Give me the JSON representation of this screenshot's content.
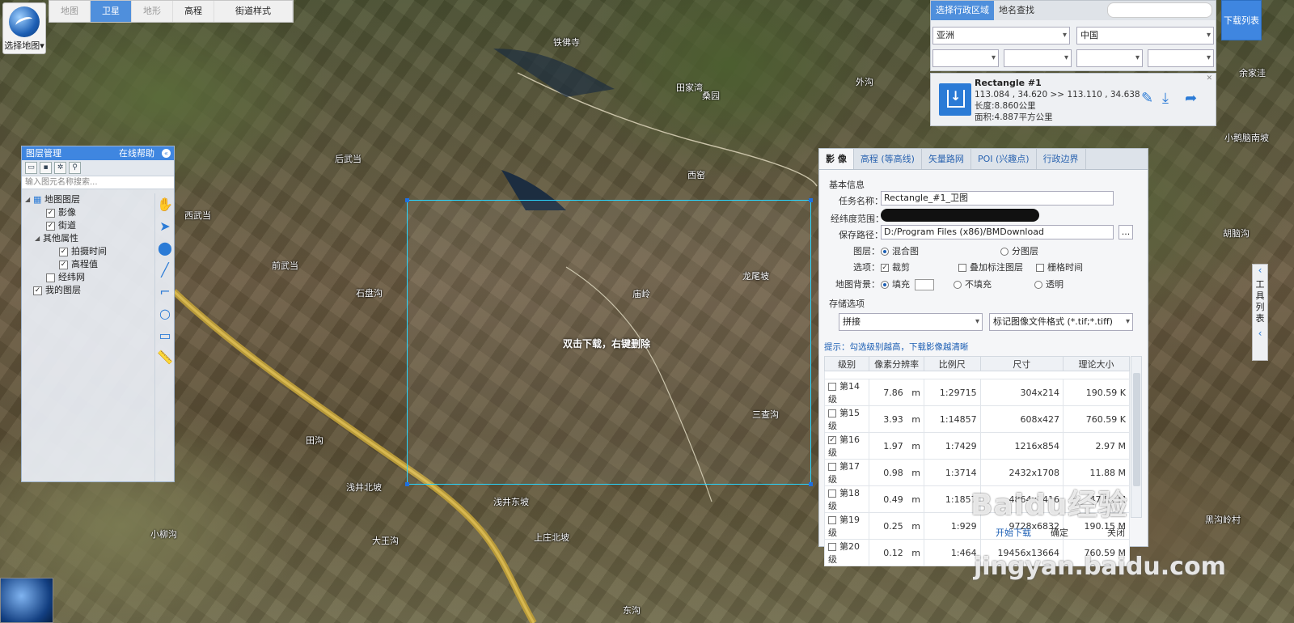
{
  "map_switch": {
    "label": "选择地图",
    "arrow": "▾"
  },
  "map_tabs": [
    "地图",
    "卫星",
    "地形",
    "高程",
    "街道样式"
  ],
  "region_panel": {
    "tabs": [
      "选择行政区域",
      "地名查找"
    ],
    "continent": "亚洲",
    "country": "中国"
  },
  "download_list_label": "下载列表",
  "rect_card": {
    "title": "Rectangle #1",
    "coords": "113.084 , 34.620 >> 113.110 , 34.638",
    "length": "长度:8.860公里",
    "area": "面积:4.887平方公里"
  },
  "layer_panel": {
    "title": "图层管理",
    "help": "在线帮助",
    "search_placeholder": "输入图元名称搜索...",
    "tree": {
      "map_layers": "地图图层",
      "imagery": "影像",
      "streets": "街道",
      "other_attr": "其他属性",
      "shot_time": "拍摄时间",
      "elevation": "高程值",
      "graticule": "经纬网",
      "my_layers": "我的图层"
    }
  },
  "selection_hint": "双击下载，右键删除",
  "places": {
    "p1": "铁佛寺",
    "p2": "田家湾",
    "p3": "外沟",
    "p4": "桑园",
    "p5": "后武当",
    "p6": "西武当",
    "p7": "前武当",
    "p8": "石盘沟",
    "p9": "西窑",
    "p10": "龙尾坡",
    "p11": "庙岭",
    "p12": "三查沟",
    "p13": "田沟",
    "p14": "浅井北坡",
    "p15": "浅井东坡",
    "p16": "上庄北坡",
    "p17": "大王沟",
    "p18": "小柳沟",
    "p19": "余家洼",
    "p20": "小鹅脑南坡",
    "p21": "胡脑沟",
    "p22": "黑沟岭村",
    "p23": "东沟"
  },
  "download_panel": {
    "tabs": [
      "影 像",
      "高程 (等高线)",
      "矢量路网",
      "POI (兴趣点)",
      "行政边界"
    ],
    "basic_info": "基本信息",
    "task_label": "任务名称：",
    "task_value": "Rectangle_#1_卫图",
    "range_label": "经纬度范围：",
    "save_label": "保存路径：",
    "save_value": "D:/Program Files (x86)/BMDownload",
    "browse": "...",
    "layer_label": "图层：",
    "layer_opt1": "混合图",
    "layer_opt2": "分图层",
    "options_label": "选项：",
    "opt_crop": "裁剪",
    "opt_overlay": "叠加标注图层",
    "opt_grid_time": "栅格时间",
    "bg_label": "地图背景：",
    "bg_fill": "填充",
    "bg_nofill": "不填充",
    "bg_transparent": "透明",
    "storage": "存储选项",
    "store_mode": "拼接",
    "store_format": "标记图像文件格式 (*.tif;*.tiff)",
    "tip": "提示：勾选级别越高，下载影像越清晰",
    "headers": [
      "级别",
      "像素分辨率",
      "比例尺",
      "尺寸",
      "理论大小"
    ],
    "rows": [
      {
        "level": "第14级",
        "res": "7.86",
        "unit": "m",
        "scale": "1:29715",
        "size": "304x214",
        "est": "190.59 K",
        "checked": false
      },
      {
        "level": "第15级",
        "res": "3.93",
        "unit": "m",
        "scale": "1:14857",
        "size": "608x427",
        "est": "760.59 K",
        "checked": false
      },
      {
        "level": "第16级",
        "res": "1.97",
        "unit": "m",
        "scale": "1:7429",
        "size": "1216x854",
        "est": "2.97 M",
        "checked": true
      },
      {
        "level": "第17级",
        "res": "0.98",
        "unit": "m",
        "scale": "1:3714",
        "size": "2432x1708",
        "est": "11.88 M",
        "checked": false
      },
      {
        "level": "第18级",
        "res": "0.49",
        "unit": "m",
        "scale": "1:1857",
        "size": "4864x3416",
        "est": "47.54 M",
        "checked": false
      },
      {
        "level": "第19级",
        "res": "0.25",
        "unit": "m",
        "scale": "1:929",
        "size": "9728x6832",
        "est": "190.15 M",
        "checked": false
      },
      {
        "level": "第20级",
        "res": "0.12",
        "unit": "m",
        "scale": "1:464",
        "size": "19456x13664",
        "est": "760.59 M",
        "checked": false
      }
    ],
    "footer_left": "开始下载",
    "footer_mid": "确定",
    "footer_right": "关闭"
  },
  "tool_list": "工具列表",
  "watermark": "Baidu经验",
  "watermark_url": "jingyan.baidu.com"
}
